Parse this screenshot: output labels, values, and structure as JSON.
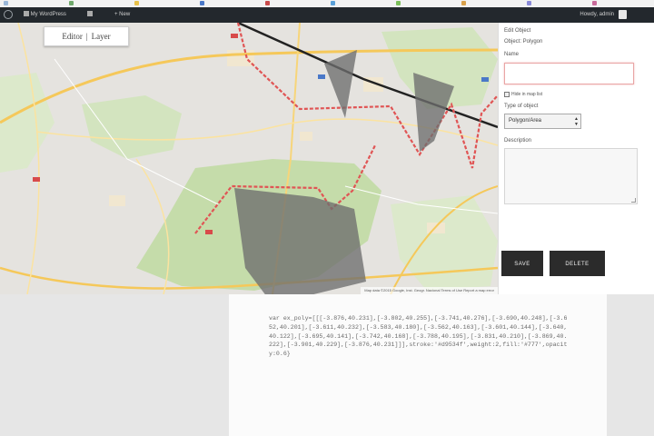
{
  "browser": {
    "tab_colors": [
      "#9ab7d8",
      "#6fa86b",
      "#e8c14a",
      "#4a78c8",
      "#c84a4a",
      "#5aa0d8",
      "#7bbf5a",
      "#d8a04a",
      "#8a8ad8",
      "#c86a9a"
    ]
  },
  "admin_bar": {
    "site_label": "My WordPress",
    "new_label": "+ New",
    "user_label": "Howdy, admin"
  },
  "map": {
    "toggle_left": "Editor",
    "toggle_sep": "|",
    "toggle_right": "Layer",
    "attribution": "Map data ©2015 Google, Inst. Geogr. Nacional   Terms of Use   Report a map error"
  },
  "panel": {
    "title": "Edit Object",
    "subtitle": "Object: Polygon",
    "name_label": "Name",
    "name_value": "",
    "checkbox_label": "Hide in map list",
    "type_label": "Type of object",
    "type_value": "Polygon/Area",
    "description_label": "Description",
    "save_label": "SAVE",
    "delete_label": "DELETE"
  },
  "content": {
    "code": "var ex_poly=[[[-3.876,40.231],[-3.802,40.255],[-3.741,40.276],[-3.690,40.248],[-3.652,40.201],[-3.611,40.232],[-3.583,40.180],[-3.562,40.163],[-3.601,40.144],[-3.640,40.122],[-3.695,40.141],[-3.742,40.168],[-3.788,40.195],[-3.831,40.210],[-3.869,40.222],[-3.901,40.229],[-3.876,40.231]]],stroke:'#d9534f',weight:2,fill:'#777',opacity:0.6}"
  }
}
